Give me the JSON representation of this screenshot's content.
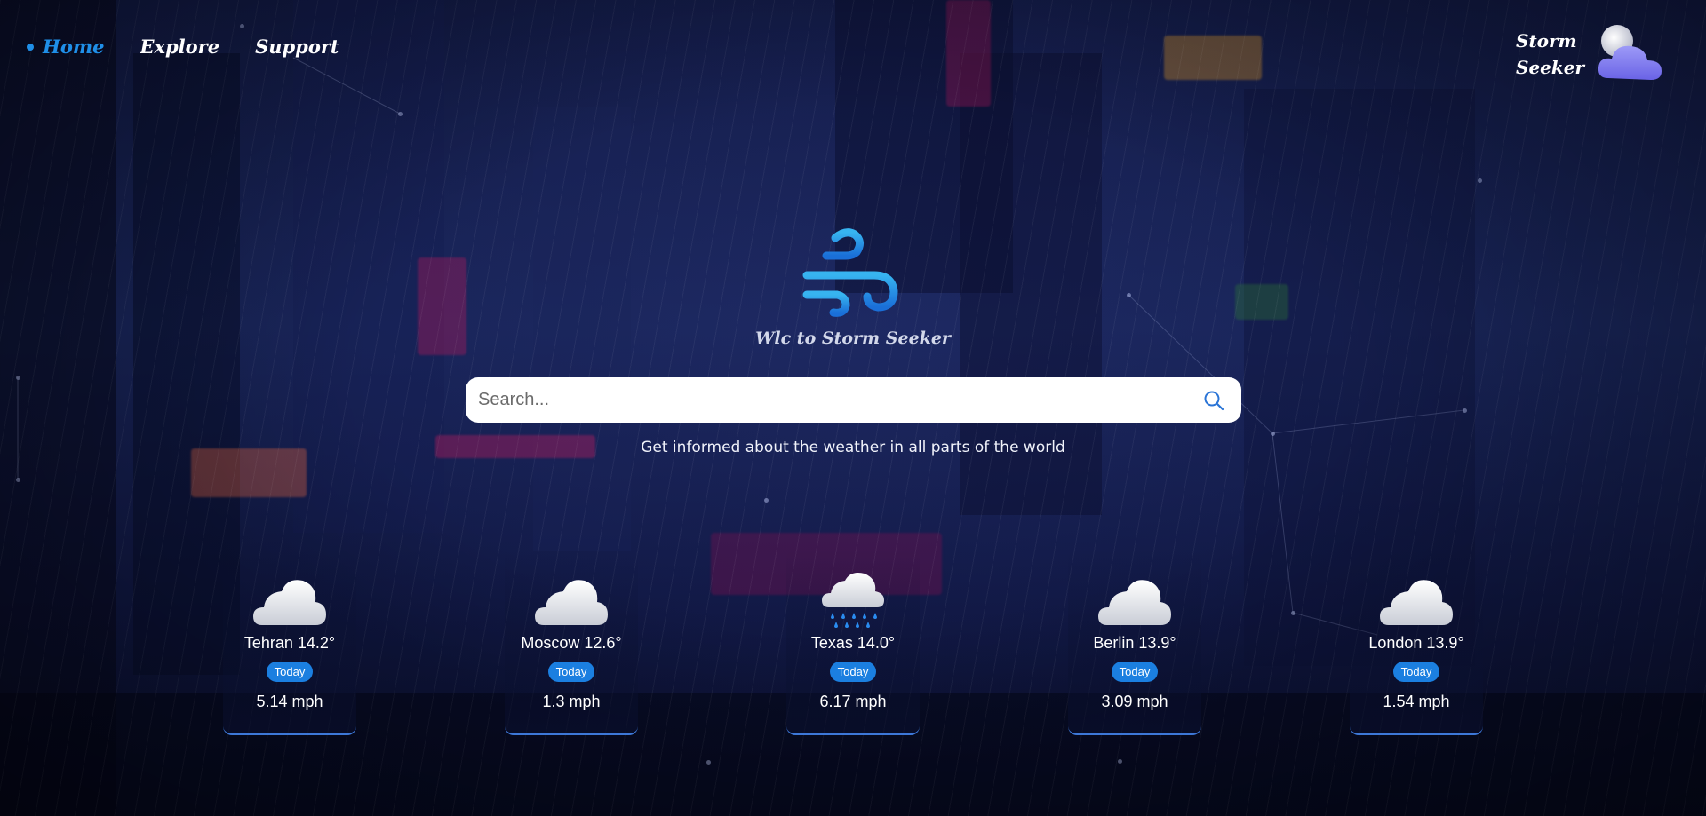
{
  "nav": {
    "items": [
      {
        "label": "Home",
        "active": true
      },
      {
        "label": "Explore",
        "active": false
      },
      {
        "label": "Support",
        "active": false
      }
    ]
  },
  "brand": {
    "line1": "Storm",
    "line2": "Seeker",
    "icon": "moon-cloud-icon"
  },
  "hero": {
    "icon": "wind-icon",
    "tagline": "Wlc to Storm Seeker"
  },
  "search": {
    "placeholder": "Search...",
    "value": "",
    "icon": "search-icon"
  },
  "subtitle": "Get informed about the weather in all parts of the world",
  "cards": [
    {
      "city": "Tehran 14.2°",
      "badge": "Today",
      "wind": "5.14 mph",
      "icon": "cloud-icon"
    },
    {
      "city": "Moscow 12.6°",
      "badge": "Today",
      "wind": "1.3 mph",
      "icon": "cloud-icon"
    },
    {
      "city": "Texas 14.0°",
      "badge": "Today",
      "wind": "6.17 mph",
      "icon": "rain-cloud-icon"
    },
    {
      "city": "Berlin 13.9°",
      "badge": "Today",
      "wind": "3.09 mph",
      "icon": "cloud-icon"
    },
    {
      "city": "London 13.9°",
      "badge": "Today",
      "wind": "1.54 mph",
      "icon": "cloud-icon"
    }
  ],
  "colors": {
    "accent": "#1f8fe8",
    "badge": "#1b7fe0",
    "background": "#141c4a"
  }
}
